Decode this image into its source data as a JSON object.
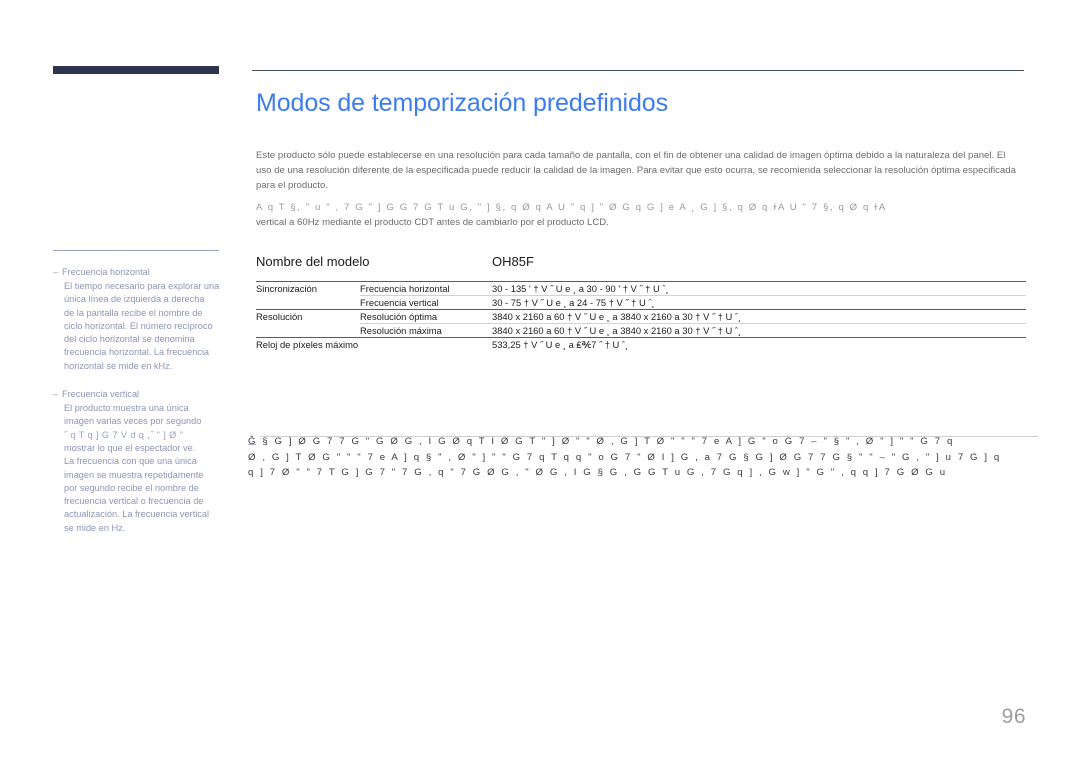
{
  "document": {
    "page_number": "96",
    "accent_title_color": "#3d7cf0",
    "nav_bar_color": "#2d3450",
    "rule_color": "#4b4f63"
  },
  "main": {
    "title": "Modos de temporización predefinidos",
    "intro_paragraph": "Este producto sólo puede establecerse en una resolución para cada tamaño de pantalla, con el fin de obtener una calidad de imagen óptima debido a la naturaleza del panel. El uso de una resolución diferente de la especificada puede reducir la calidad de la imagen. Para evitar que esto ocurra, se recomienda seleccionar la resolución óptima especificada para el producto.",
    "garbled_line": "A q T §,  \" u \" , 7 G \" ]   G  G 7   G T u  G,  \"   ]  §, q    Ø q  A U   \" q ] \"  Ø G  q  G   ] e A ¸  G   ] §, q    Ø q  ɫA U      \" 7  §, q     Ø q  ɫA",
    "intro_tail": "vertical a 60Hz mediante el producto CDT antes de cambiarlo por el producto LCD."
  },
  "table": {
    "header": {
      "label": "Nombre del modelo",
      "model": "OH85F"
    },
    "rows": [
      {
        "group": "Sincronización",
        "subrows": [
          {
            "label": "Frecuencia horizontal",
            "value": "30 - 135   ' † V  ˝ U e ¸ a  30 - 90   ' † V  ˝ † U   ˆ¸"
          },
          {
            "label": "Frecuencia vertical",
            "value": "30 - 75   † V  ˝ U e ¸ a  24 - 75   † V  ˝ † U   ˆ¸"
          }
        ]
      },
      {
        "group": "Resolución",
        "subrows": [
          {
            "label": "Resolución óptima",
            "value": "3840 x 2160 a 60   † V  ˝ U e ¸ a  3840 x 2160 a 30   † V  ˝ † U   ˆ¸"
          },
          {
            "label": "Resolución máxima",
            "value": "3840 x 2160 a 60   † V  ˝ U e ¸ a  3840 x 2160 a 30   † V  ˝ † U   ˆ¸"
          }
        ]
      },
      {
        "group": "Reloj de píxeles máximo",
        "subrows": [
          {
            "label": "",
            "value": "533,25    † V  ˝ U e ¸ a ₤℀7 ˝ † U   ˆ¸"
          }
        ]
      }
    ]
  },
  "sidebar": {
    "notes": [
      {
        "dash": "–",
        "title": "Frecuencia horizontal",
        "body": "El tiempo necesario para explorar una\núnica línea de izquierda a derecha\nde la pantalla recibe el nombre de\nciclo horizontal. El número recíproco\ndel ciclo horizontal se denomina\nfrecuencia horizontal. La frecuencia\nhorizontal se mide en kHz."
      },
      {
        "dash": "–",
        "title": "Frecuencia vertical",
        "body": "El producto muestra una única\nimagen varias veces por segundo"
      }
    ],
    "garbled_note": "˝  q T q   ] G  7  V  d  q ,˝   \" ] Ø \"",
    "note_tail": "mostrar lo que el espectador ve.\nLa frecuencia con que una única\nimagen se muestra repetidamente\npor segundo recibe el nombre de\nfrecuencia vertical o frecuencia de\nactualización. La frecuencia vertical\nse mide en Hz."
  },
  "bottom_note": {
    "bullet": "―",
    "lines": [
      "Ĝ  § G ] Ø G 7 7 G   \"  G    Ø G , I  G  Ø q T I Ø   G T \" ] Ø \"      \"  Ø , G ]  T  Ø \"   \"   \" 7  e A   ] G   \" o G 7  –  \" § \" , Ø \" ] \"  \"  G  7 q",
      "Ø , G ]  T  Ø   G   \"   \" \" 7  e A  ] q  § \" , Ø \" ] \"  \"  G  7 q   T q  q     \" o G 7 \"  Ø I ]  G , a  7 G  § G ] Ø G 7 7 G  §  \"  \"  –  \"  G ,  \" ]  u 7 G ]  q",
      "q ]   7 Ø \"  \" 7  T G ]  G 7   \" 7     G ,  q   \" 7 G  Ø G , \" Ø G   , I    G  § G , G   G T u  G , 7 G   q ]     , G   w ]  \"  G  \" ,  q   q ]  7 G  Ø G u"
    ]
  }
}
